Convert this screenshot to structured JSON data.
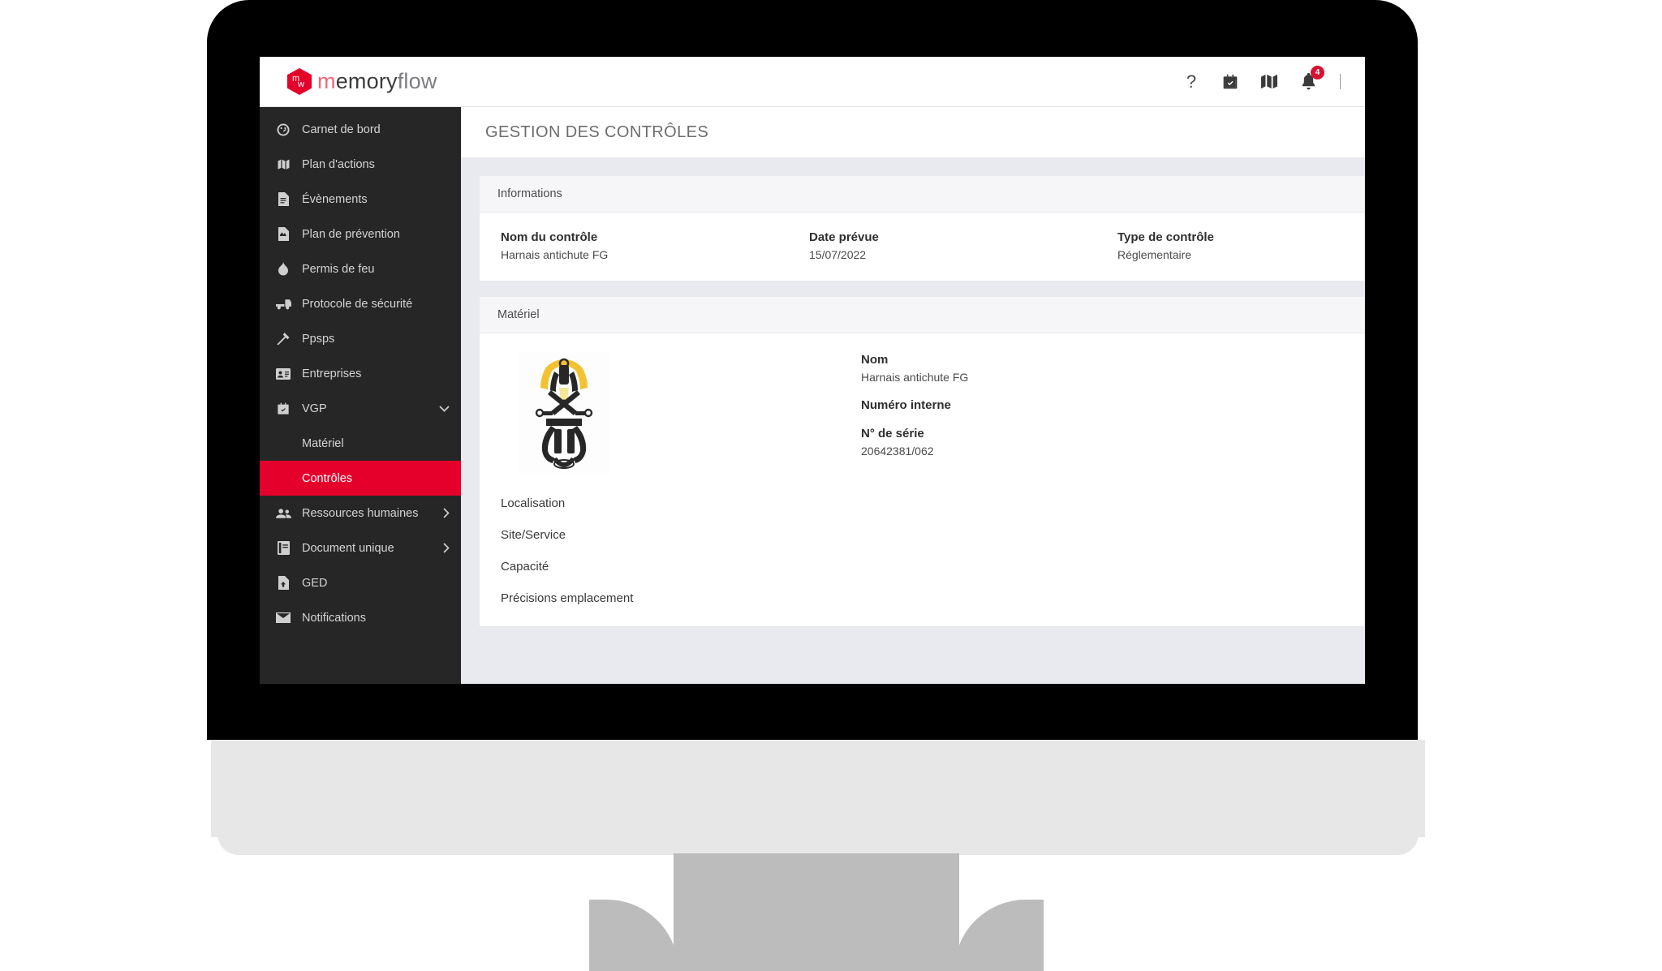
{
  "brand": {
    "logo_icon": "hexagon-mw-logo",
    "logo_letter_1": "m",
    "logo_letter_2": "w",
    "name_part_accent": "m",
    "name_part_dark": "emory",
    "name_part_light": "flow"
  },
  "topbar": {
    "icons": [
      {
        "name": "help-icon",
        "glyph": "?"
      },
      {
        "name": "calendar-check-icon"
      },
      {
        "name": "map-icon"
      },
      {
        "name": "bell-icon"
      }
    ],
    "notification_count": "4"
  },
  "sidebar": {
    "items": [
      {
        "label": "Carnet de bord",
        "icon": "dashboard-icon",
        "expandable": false
      },
      {
        "label": "Plan d'actions",
        "icon": "map-icon",
        "expandable": false
      },
      {
        "label": "Évènements",
        "icon": "document-icon",
        "expandable": false
      },
      {
        "label": "Plan de prévention",
        "icon": "document-image-icon",
        "expandable": false
      },
      {
        "label": "Permis de feu",
        "icon": "flame-icon",
        "expandable": false
      },
      {
        "label": "Protocole de sécurité",
        "icon": "truck-icon",
        "expandable": false
      },
      {
        "label": "Ppsps",
        "icon": "hammer-icon",
        "expandable": false
      },
      {
        "label": "Entreprises",
        "icon": "id-card-icon",
        "expandable": false
      },
      {
        "label": "VGP",
        "icon": "calendar-check-icon",
        "expandable": true,
        "expanded": true
      }
    ],
    "vgp_submenu": [
      {
        "label": "Matériel",
        "active": false
      },
      {
        "label": "Contrôles",
        "active": true
      }
    ],
    "items_after": [
      {
        "label": "Ressources humaines",
        "icon": "users-icon",
        "expandable": true,
        "expanded": false
      },
      {
        "label": "Document unique",
        "icon": "book-icon",
        "expandable": true,
        "expanded": false
      },
      {
        "label": "GED",
        "icon": "file-up-icon",
        "expandable": false
      },
      {
        "label": "Notifications",
        "icon": "envelope-icon",
        "expandable": false
      }
    ]
  },
  "page": {
    "title": "GESTION DES CONTRÔLES"
  },
  "informations_card": {
    "header": "Informations",
    "fields": [
      {
        "label": "Nom du contrôle",
        "value": "Harnais antichute FG"
      },
      {
        "label": "Date prévue",
        "value": "15/07/2022"
      },
      {
        "label": "Type de contrôle",
        "value": "Réglementaire"
      }
    ]
  },
  "materiel_card": {
    "header": "Matériel",
    "image_alt": "safety-harness-photo",
    "left_labels": [
      "Localisation",
      "Site/Service",
      "Capacité",
      "Précisions emplacement"
    ],
    "right_fields": [
      {
        "label": "Nom",
        "value": "Harnais antichute FG"
      },
      {
        "label": "Numéro interne",
        "value": ""
      },
      {
        "label": "N° de série",
        "value": "20642381/062"
      }
    ]
  },
  "colors": {
    "accent_red": "#e4002b",
    "badge_red": "#d81132",
    "sidebar_bg": "#262626",
    "page_bg": "#e9eaef",
    "card_head_bg": "#f6f6f8"
  }
}
